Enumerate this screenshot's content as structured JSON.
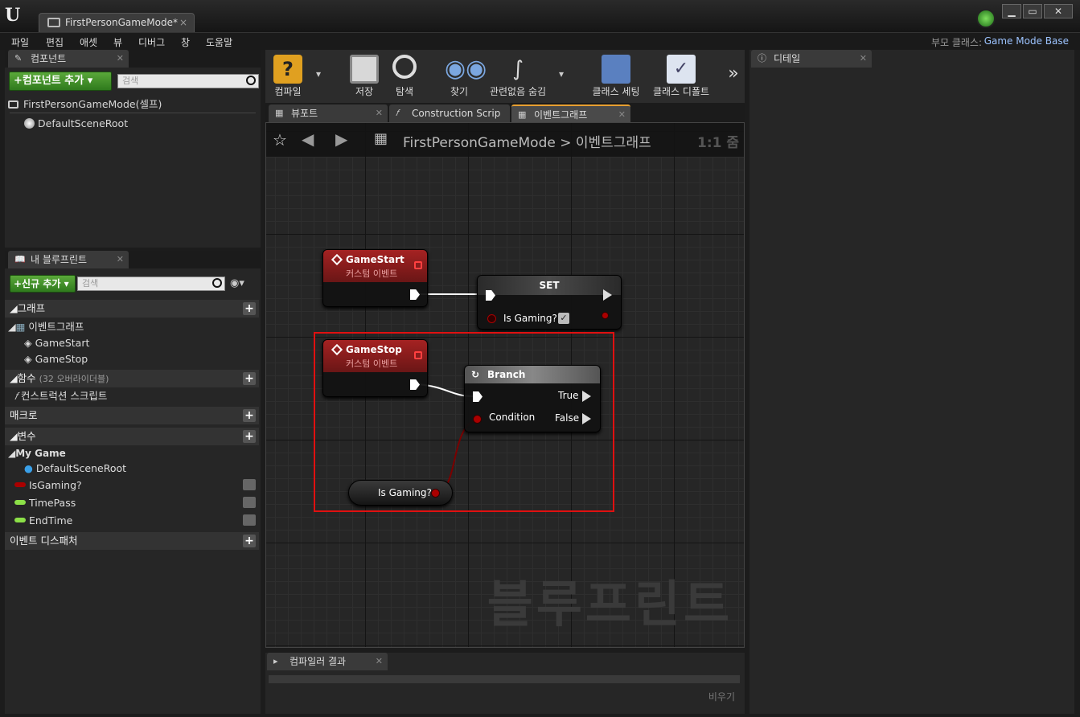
{
  "window": {
    "doc_tab": "FirstPersonGameMode*",
    "close": "×",
    "controls": [
      "▁",
      "▭",
      "✕"
    ]
  },
  "menu": {
    "items": [
      "파일",
      "편집",
      "애셋",
      "뷰",
      "디버그",
      "창",
      "도움말"
    ],
    "parent_label": "부모 클래스:",
    "parent_value": "Game Mode Base"
  },
  "components": {
    "tab": "컴포넌트",
    "add_button": "+컴포넌트 추가",
    "search_placeholder": "검색",
    "root": "FirstPersonGameMode(셀프)",
    "child": "DefaultSceneRoot"
  },
  "myblueprint": {
    "tab": "내 블루프린트",
    "add_button": "+신규 추가",
    "search_placeholder": "검색",
    "graph_cat": "그래프",
    "event_graph": "이벤트그래프",
    "events": [
      "GameStart",
      "GameStop"
    ],
    "functions_cat": "함수",
    "functions_note": "(32 오버라이더블)",
    "construction": "컨스트럭션 스크립트",
    "macros_cat": "매크로",
    "vars_cat": "변수",
    "var_group": "My Game",
    "variables": [
      "DefaultSceneRoot",
      "IsGaming?",
      "TimePass",
      "EndTime"
    ],
    "dispatchers_cat": "이벤트 디스패처"
  },
  "toolbar": {
    "compile": "컴파일",
    "save": "저장",
    "browse": "탐색",
    "find": "찾기",
    "hide_unrelated": "관련없음 숨김",
    "class_settings": "클래스 세팅",
    "class_defaults": "클래스 디폴트"
  },
  "editor_tabs": {
    "viewport": "뷰포트",
    "construction": "Construction Scrip",
    "event_graph": "이벤트그래프"
  },
  "graph": {
    "crumb_root": "FirstPersonGameMode",
    "crumb_sep": ">",
    "crumb_current": "이벤트그래프",
    "zoom": "1:1 줌",
    "watermark": "블루프린트",
    "node_gamestart": {
      "title": "GameStart",
      "subtitle": "커스텀 이벤트"
    },
    "node_set": {
      "title": "SET",
      "var": "Is Gaming?"
    },
    "node_gamestop": {
      "title": "GameStop",
      "subtitle": "커스텀 이벤트"
    },
    "node_branch": {
      "title": "Branch",
      "cond": "Condition",
      "true": "True",
      "false": "False"
    },
    "node_getter": {
      "label": "Is Gaming?"
    }
  },
  "compiler": {
    "tab": "컴파일러 결과",
    "clear": "비우기"
  },
  "details": {
    "tab": "디테일"
  }
}
